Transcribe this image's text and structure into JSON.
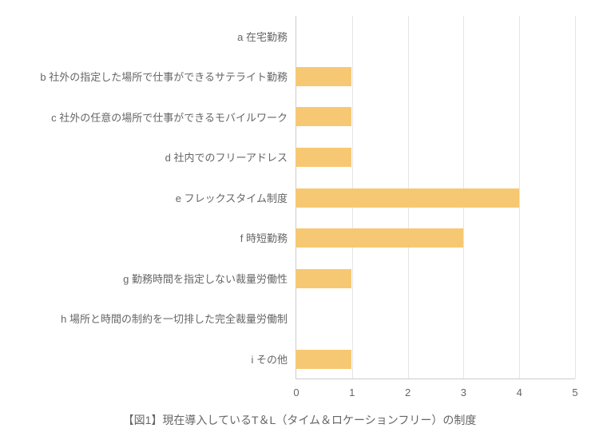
{
  "chart_data": {
    "type": "bar",
    "orientation": "horizontal",
    "categories": [
      "a 在宅勤務",
      "b 社外の指定した場所で仕事ができるサテライト勤務",
      "c 社外の任意の場所で仕事ができるモバイルワーク",
      "d 社内でのフリーアドレス",
      "e フレックスタイム制度",
      "f 時短勤務",
      "g 勤務時間を指定しない裁量労働性",
      "h 場所と時間の制約を一切排した完全裁量労働制",
      "i その他"
    ],
    "values": [
      0,
      1,
      1,
      1,
      4,
      3,
      1,
      0,
      1
    ],
    "xlim": [
      0,
      5
    ],
    "xticks": [
      0,
      1,
      2,
      3,
      4,
      5
    ],
    "title": "【図1】現在導入しているT＆L（タイム＆ロケーションフリー）の制度",
    "bar_color": "#f7c873",
    "ylabel": "",
    "xlabel": ""
  }
}
